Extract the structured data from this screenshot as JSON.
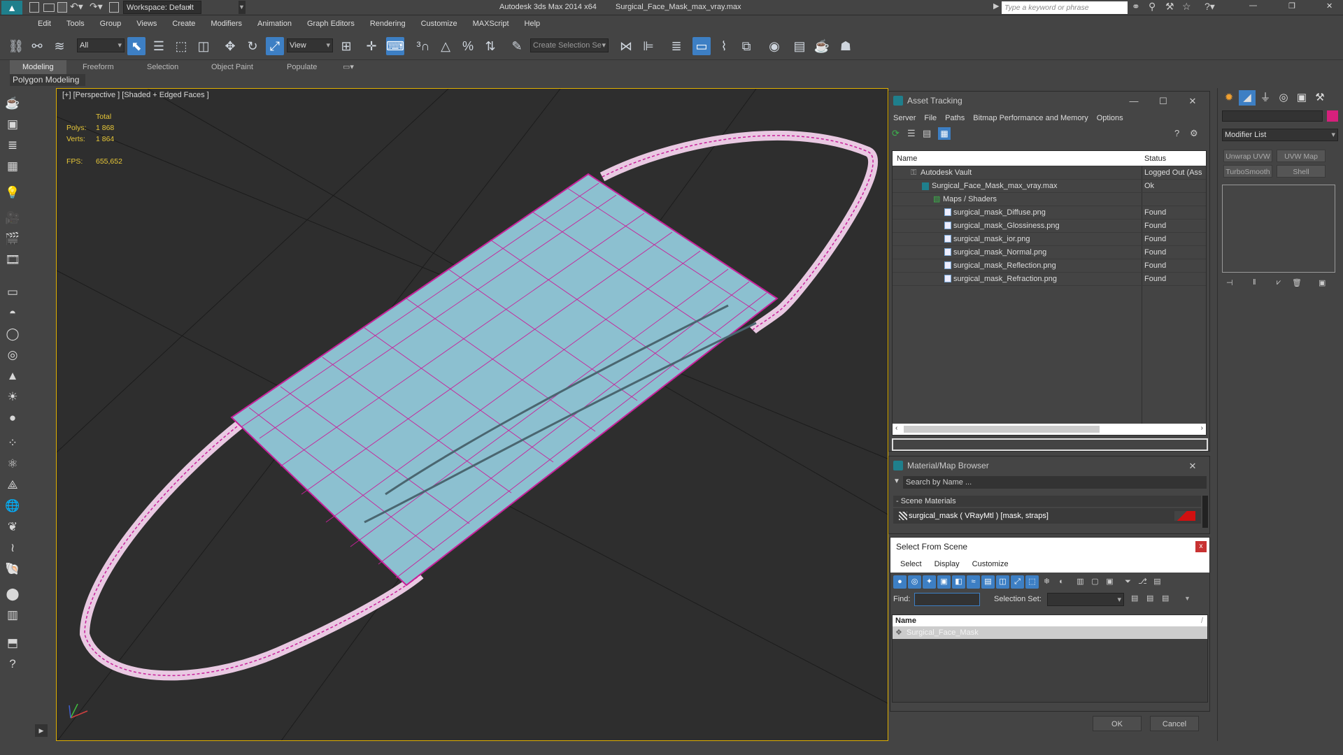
{
  "titlebar": {
    "workspace": "Workspace: Default",
    "app": "Autodesk 3ds Max  2014 x64",
    "file": "Surgical_Face_Mask_max_vray.max",
    "search_placeholder": "Type a keyword or phrase",
    "min": "—",
    "max": "❐",
    "close": "✕"
  },
  "menu": [
    "Edit",
    "Tools",
    "Group",
    "Views",
    "Create",
    "Modifiers",
    "Animation",
    "Graph Editors",
    "Rendering",
    "Customize",
    "MAXScript",
    "Help"
  ],
  "toolbar": {
    "filter": "All",
    "refcoord": "View",
    "selset_placeholder": "Create Selection Se"
  },
  "ribbon": {
    "tabs": [
      "Modeling",
      "Freeform",
      "Selection",
      "Object Paint",
      "Populate"
    ],
    "panel": "Polygon Modeling"
  },
  "viewport": {
    "label": "[+] [Perspective ] [Shaded + Edged Faces ]",
    "stats": {
      "total": "Total",
      "polys_label": "Polys:",
      "polys": "1 868",
      "verts_label": "Verts:",
      "verts": "1 864",
      "fps_label": "FPS:",
      "fps": "655,652"
    }
  },
  "asset_tracking": {
    "title": "Asset Tracking",
    "menu": [
      "Server",
      "File",
      "Paths",
      "Bitmap Performance and Memory",
      "Options"
    ],
    "cols": [
      "Name",
      "Status"
    ],
    "rows": [
      {
        "name": "Autodesk Vault",
        "status": "Logged Out (Ass"
      },
      {
        "name": "Surgical_Face_Mask_max_vray.max",
        "status": "Ok"
      },
      {
        "name": "Maps / Shaders",
        "status": ""
      },
      {
        "name": "surgical_mask_Diffuse.png",
        "status": "Found"
      },
      {
        "name": "surgical_mask_Glossiness.png",
        "status": "Found"
      },
      {
        "name": "surgical_mask_ior.png",
        "status": "Found"
      },
      {
        "name": "surgical_mask_Normal.png",
        "status": "Found"
      },
      {
        "name": "surgical_mask_Reflection.png",
        "status": "Found"
      },
      {
        "name": "surgical_mask_Refraction.png",
        "status": "Found"
      }
    ]
  },
  "material_browser": {
    "title": "Material/Map Browser",
    "search_placeholder": "Search by Name ...",
    "group": "- Scene Materials",
    "item": "surgical_mask  ( VRayMtl ) [mask, straps]"
  },
  "select_scene": {
    "title": "Select From Scene",
    "menu": [
      "Select",
      "Display",
      "Customize"
    ],
    "find_label": "Find:",
    "selset_label": "Selection Set:",
    "col": "Name",
    "item": "Surgical_Face_Mask",
    "ok": "OK",
    "cancel": "Cancel"
  },
  "cmdpanel": {
    "modifier_list": "Modifier List",
    "buttons": [
      "Unwrap UVW",
      "UVW Map",
      "TurboSmooth",
      "Shell"
    ]
  },
  "colors": {
    "accent": "#3d7fc4",
    "wire": "#c8209a",
    "mask": "#8cc0d0",
    "viewport_border": "#e0b000",
    "stats": "#e8c838"
  }
}
